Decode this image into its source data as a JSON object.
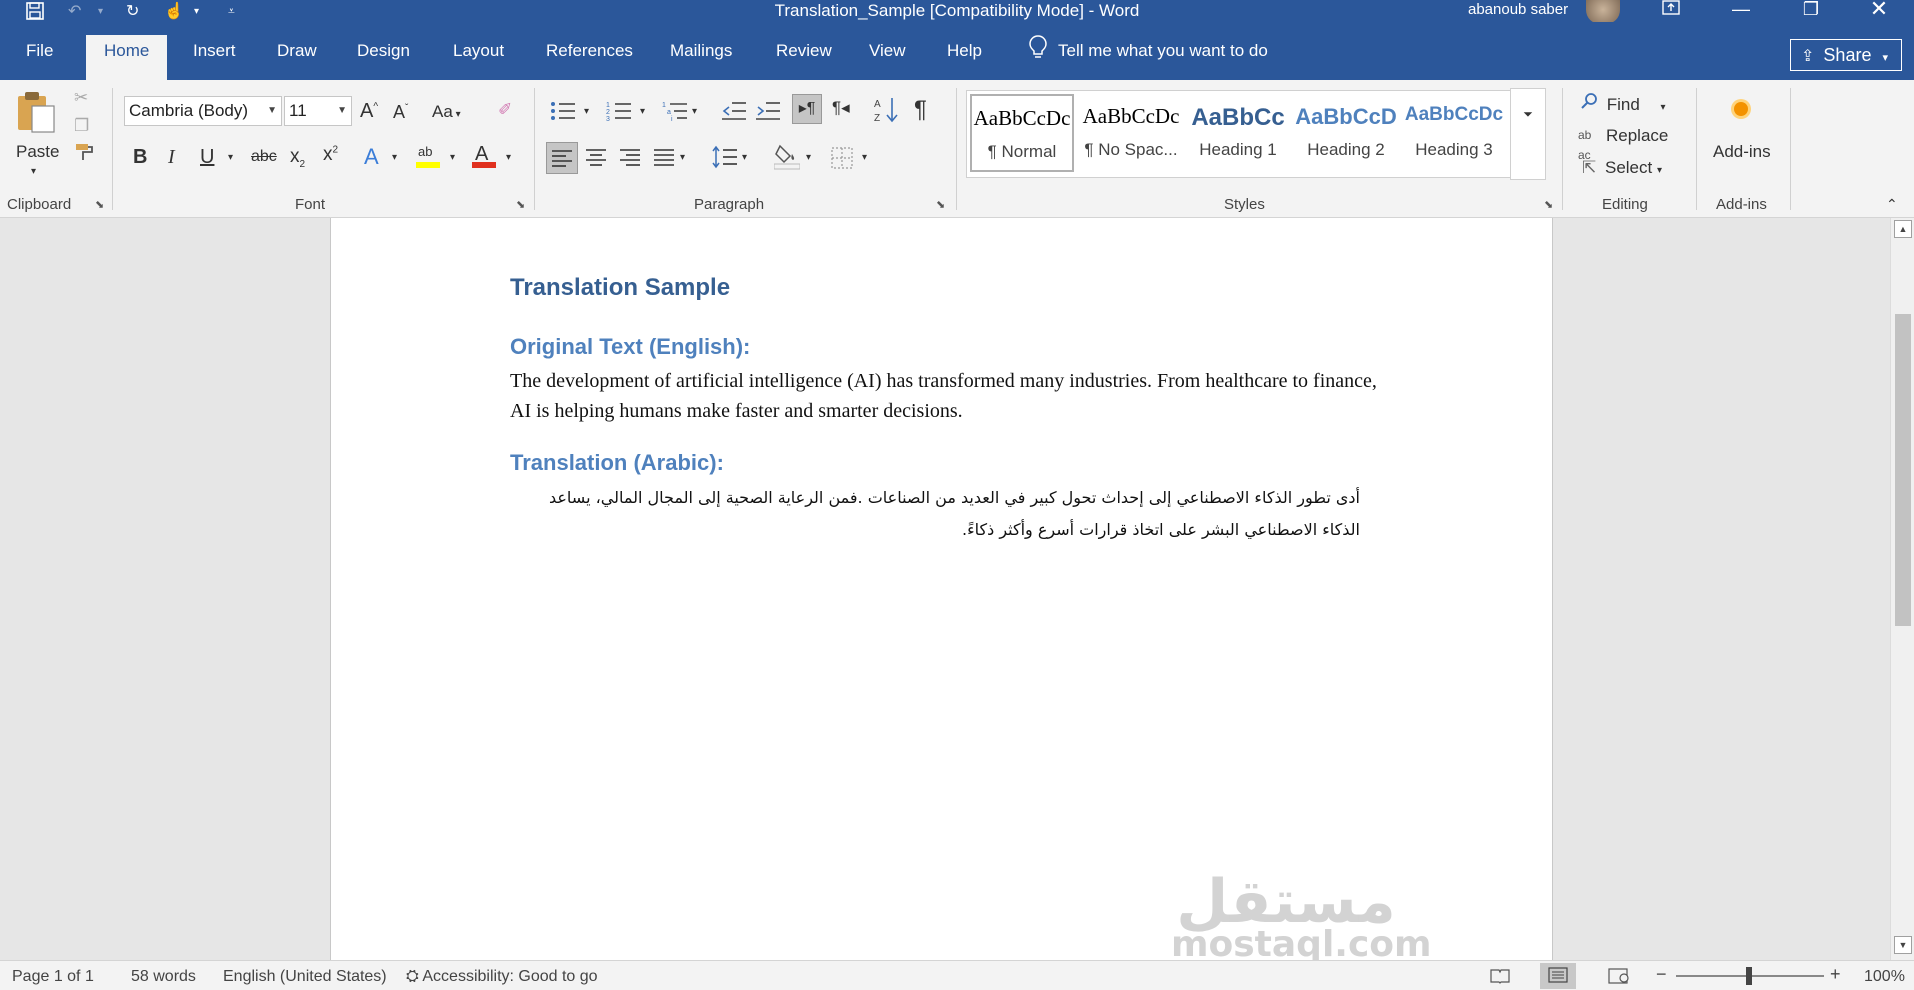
{
  "titlebar": {
    "document_title": "Translation_Sample [Compatibility Mode]  -  Word",
    "user_name": "abanoub saber"
  },
  "tabs": [
    "File",
    "Home",
    "Insert",
    "Draw",
    "Design",
    "Layout",
    "References",
    "Mailings",
    "Review",
    "View",
    "Help"
  ],
  "tell_me": "Tell me what you want to do",
  "share_label": "Share",
  "ribbon": {
    "clipboard": {
      "paste_label": "Paste",
      "group_label": "Clipboard"
    },
    "font": {
      "font_name": "Cambria (Body)",
      "font_size": "11",
      "change_case": "Aa",
      "group_label": "Font"
    },
    "paragraph": {
      "group_label": "Paragraph"
    },
    "styles": {
      "items": [
        {
          "sample": "AaBbCcDc",
          "name": "¶ Normal"
        },
        {
          "sample": "AaBbCcDc",
          "name": "¶ No Spac..."
        },
        {
          "sample": "AaBbCc",
          "name": "Heading 1"
        },
        {
          "sample": "AaBbCcD",
          "name": "Heading 2"
        },
        {
          "sample": "AaBbCcDc",
          "name": "Heading 3"
        }
      ],
      "group_label": "Styles"
    },
    "editing": {
      "find": "Find",
      "replace": "Replace",
      "select": "Select",
      "group_label": "Editing"
    },
    "addins": {
      "button_label": "Add-ins",
      "group_label": "Add-ins"
    }
  },
  "document": {
    "title": "Translation Sample",
    "section1_heading": "Original Text (English):",
    "section1_body": "The development of artificial intelligence (AI) has transformed many industries. From healthcare to finance, AI is helping humans make faster and smarter decisions.",
    "section2_heading": "Translation (Arabic):",
    "section2_body": "أدى تطور الذكاء الاصطناعي إلى إحداث تحول كبير في العديد من الصناعات .فمن الرعاية الصحية إلى المجال المالي، يساعد الذكاء الاصطناعي البشر على اتخاذ قرارات أسرع وأكثر ذكاءً.",
    "watermark_ar": "مستقل",
    "watermark_en": "mostaql.com"
  },
  "statusbar": {
    "page": "Page 1 of 1",
    "words": "58 words",
    "language": "English (United States)",
    "accessibility": "Accessibility: Good to go",
    "zoom": "100%"
  }
}
